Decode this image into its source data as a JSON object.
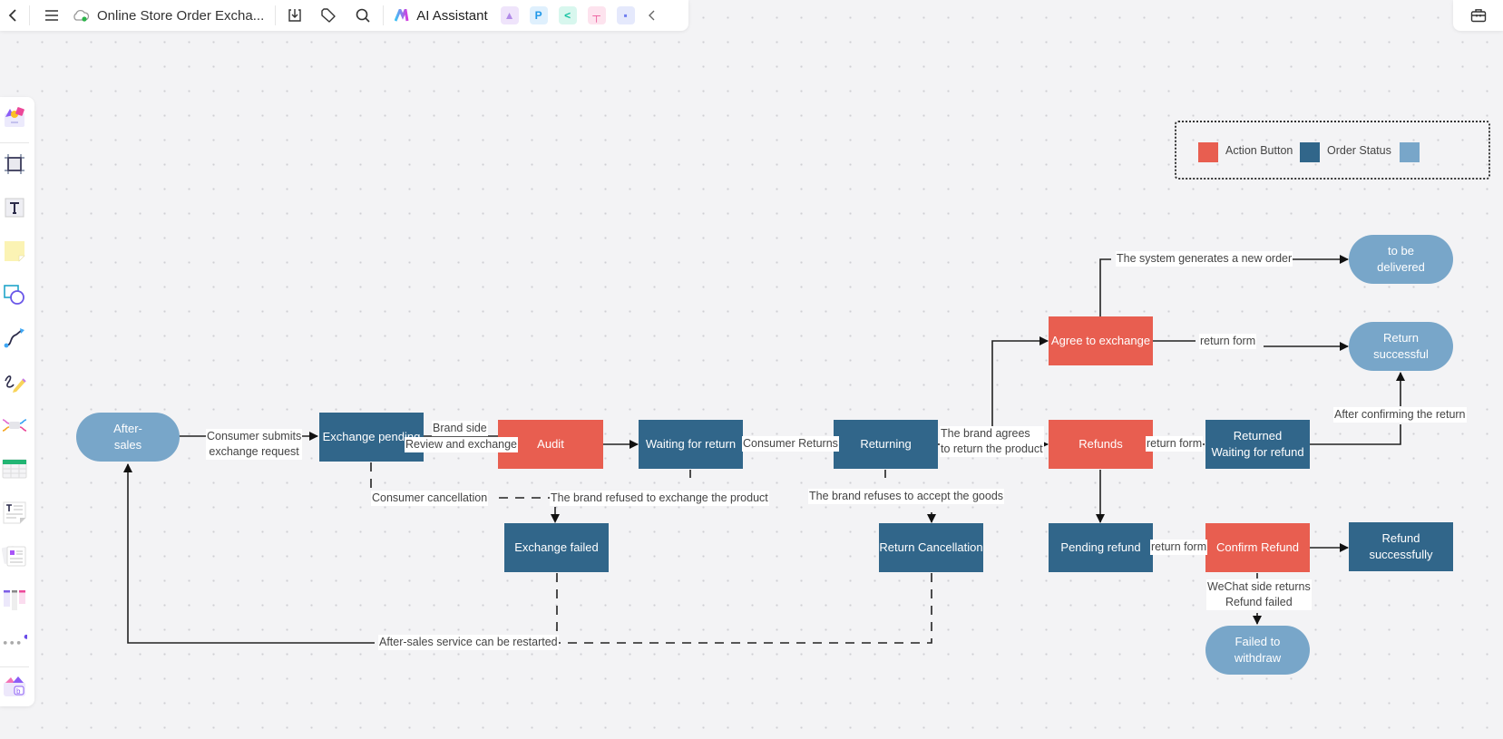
{
  "toolbar": {
    "title": "Online Store Order Excha...",
    "ai_assistant": "AI Assistant",
    "icons": [
      "back-icon",
      "menu-icon",
      "cloud-sync-icon",
      "download-icon",
      "tag-icon",
      "search-icon",
      "ai-logo-icon",
      "image-gen-icon",
      "p-app-icon",
      "mindmap-app-icon",
      "flow-app-icon",
      "chat-app-icon",
      "collapse-icon"
    ],
    "right_icon": "toolbox-icon"
  },
  "sidebar": {
    "items": [
      "templates",
      "frame",
      "text",
      "sticky-note",
      "shape",
      "connector",
      "pen",
      "mindmap",
      "table",
      "text-doc",
      "card",
      "kanban",
      "more",
      "plugin"
    ]
  },
  "legend": {
    "items": [
      {
        "label": "Action Button",
        "color": "#e85e50"
      },
      {
        "label": "Order Status",
        "color": "#31668a"
      },
      {
        "label": "",
        "color": "#78a6c9"
      }
    ]
  },
  "nodes": {
    "after_sales": "After-\nsales",
    "exchange_pending": "Exchange pending",
    "audit": "Audit",
    "waiting_return": "Waiting for return",
    "returning": "Returning",
    "agree_exchange": "Agree to exchange",
    "refunds": "Refunds",
    "to_be_delivered": "to be\ndelivered",
    "return_successful": "Return\nsuccessful",
    "returned_waiting": "Returned\nWaiting for refund",
    "exchange_failed": "Exchange failed",
    "return_cancellation": "Return Cancellation",
    "pending_refund": "Pending refund",
    "confirm_refund": "Confirm Refund",
    "refund_successfully": "Refund successfully",
    "failed_withdraw": "Failed to\nwithdraw"
  },
  "edge_labels": {
    "consumer_submits": "Consumer submits\nexchange request",
    "brand_side": "Brand side",
    "review_exchange": "Review and exchange",
    "consumer_cancellation": "Consumer cancellation",
    "brand_refused": "The brand refused to exchange the product",
    "consumer_returns": "Consumer Returns",
    "brand_refuses_goods": "The brand refuses to accept the goods",
    "brand_agrees": "The brand agrees\nto return the product",
    "system_generates": "The system generates a new order",
    "return_form_1": "return form",
    "return_form_2": "return form",
    "return_form_3": "return form",
    "after_confirming": "After confirming the return",
    "wechat_fail": "WeChat side returns\nRefund failed",
    "restart": "After-sales service can be restarted"
  }
}
